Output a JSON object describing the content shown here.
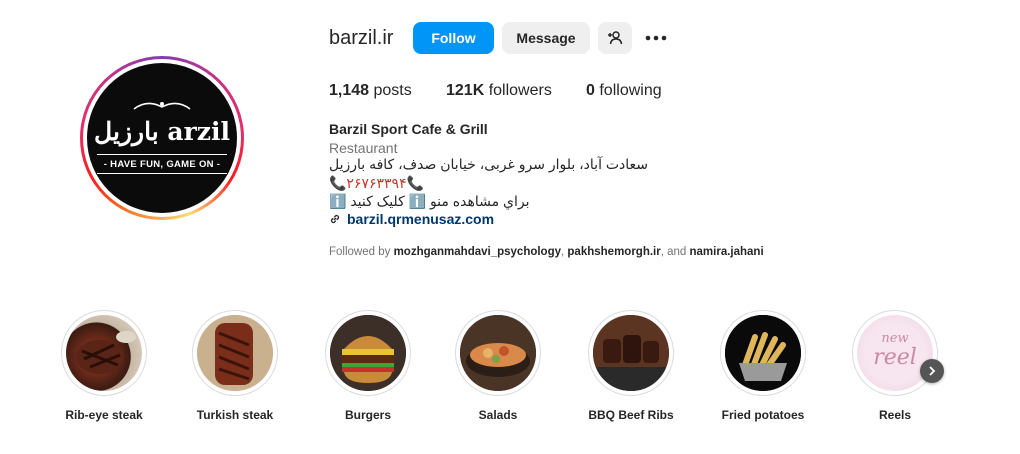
{
  "profile": {
    "username": "barzil.ir",
    "full_name": "Barzil Sport Cafe & Grill",
    "category": "Restaurant",
    "logo_text": "بارزیل arzil",
    "logo_tagline": "- HAVE FUN, GAME ON -",
    "bio_lines": [
      "سعادت آباد، بلوار سرو غربی، خیابان صدف، کافه بارزیل",
      "📞۲۶۷۶۳۳۹۴📞",
      "براي مشاهده منو ℹ️ کلیک کنید ℹ️"
    ],
    "website": "barzil.qrmenusaz.com"
  },
  "actions": {
    "follow_label": "Follow",
    "message_label": "Message",
    "add_user_icon": "add-user-icon",
    "more_icon": "more-options-icon"
  },
  "stats": {
    "posts_count": "1,148",
    "posts_label": "posts",
    "followers_count": "121K",
    "followers_label": "followers",
    "following_count": "0",
    "following_label": "following"
  },
  "followed_by": {
    "prefix": "Followed by",
    "users": [
      "mozhganmahdavi_psychology",
      "pakhshemorgh.ir",
      "namira.jahani"
    ],
    "sep1": ", ",
    "sep2": ", and "
  },
  "highlights": [
    {
      "label": "Rib-eye steak"
    },
    {
      "label": "Turkish steak"
    },
    {
      "label": "Burgers"
    },
    {
      "label": "Salads"
    },
    {
      "label": "BBQ Beef Ribs"
    },
    {
      "label": "Fried potatoes"
    },
    {
      "label": "Reels",
      "thumb_text": [
        "new",
        "reel"
      ]
    }
  ],
  "colors": {
    "follow_blue": "#0095f6",
    "button_gray": "#efefef",
    "link_blue": "#00376b",
    "muted_text": "#737373"
  }
}
